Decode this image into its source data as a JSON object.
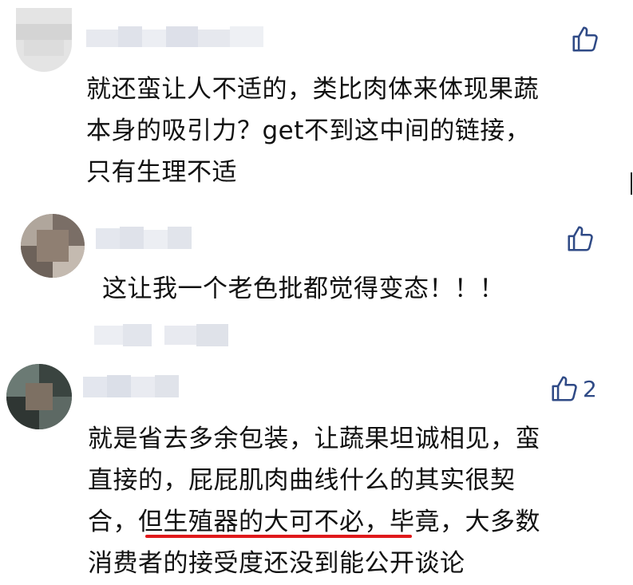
{
  "comments": [
    {
      "text": "就还蛮让人不适的，类比肉体来体现果蔬\n本身的吸引力？get不到这中间的链接，\n只有生理不适",
      "likes": ""
    },
    {
      "text": "这让我一个老色批都觉得变态！！！",
      "likes": ""
    },
    {
      "text_before": "就是省去多余包装，让蔬果坦诚相见，蛮\n直接的，屁屁肌肉曲线什么的其实很契\n合，",
      "text_highlight": "但生殖器的大可不必，",
      "text_after": "毕竟，大多数\n消费者的接受度还没到能公开谈论",
      "likes": "2"
    }
  ],
  "colors": {
    "like_icon": "#2f4a86",
    "underline": "#e0191b",
    "text": "#111111"
  },
  "icons": {
    "like": "thumbs-up-icon"
  }
}
